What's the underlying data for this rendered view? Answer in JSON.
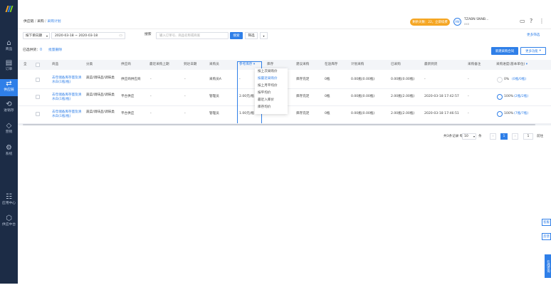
{
  "colors": {
    "primary": "#2f7fe8",
    "sidebar": "#1c2c46",
    "warning": "#f5a623",
    "link": "#2f7fe8"
  },
  "sidebar": {
    "logo_colors": [
      "#f5a623",
      "#2f7fe8",
      "#7ed321"
    ],
    "items": [
      {
        "label": "商品",
        "icon": "shop-icon",
        "glyph": "⌂"
      },
      {
        "label": "订单",
        "icon": "order-icon",
        "glyph": "▤"
      },
      {
        "label": "供应链",
        "icon": "supply-chain-icon",
        "glyph": "⇄"
      },
      {
        "label": "进销存",
        "icon": "inventory-icon",
        "glyph": "⟲"
      },
      {
        "label": "营销",
        "icon": "marketing-icon",
        "glyph": "◇"
      },
      {
        "label": "系统",
        "icon": "system-icon",
        "glyph": "⚙"
      },
      {
        "label": "应用中心",
        "icon": "app-center-icon",
        "glyph": "☷"
      },
      {
        "label": "供应中台",
        "icon": "supply-platform-icon",
        "glyph": "⬡"
      }
    ]
  },
  "header": {
    "breadcrumb": [
      "供应链",
      "采购",
      "采购计划"
    ],
    "trial_badge": "剩余天数：22，立即续费",
    "avatar_text": "AW",
    "user_line1": "TZABN SNNB...",
    "user_line2": "xxx",
    "icons": [
      "chat-icon",
      "help-icon",
      "more-icon"
    ]
  },
  "filters": {
    "date_type": "按下单日期",
    "date_range": "2020-03-18 ~ 2020-03-18",
    "search_label": "搜索",
    "search_placeholder": "输入订单号、商品名称或商家",
    "search_button": "搜索",
    "reset_button": "筛选",
    "more_filters": "更多筛选"
  },
  "toolbar": {
    "summary_prefix": "已选供货：",
    "summary_count": "0",
    "clear_link": "批量删除",
    "new_button": "新建采购合同",
    "more_button": "更多功能"
  },
  "table": {
    "headers": [
      "全",
      "",
      "商品",
      "分类",
      "供应商",
      "最近采购上期",
      "到达日期",
      "采购员",
      "参考库存",
      "库存",
      "建议采购",
      "在途库存",
      "计划采购",
      "已采购",
      "最新到货",
      "采购备注",
      "采购进度(基本单位)"
    ],
    "rows": [
      {
        "product": "去年储备库存量及清水白(1瓶/瓶)",
        "category": "蔬菜/调味品/调味类",
        "supplier": "供应商供应商",
        "last_cycle": "-",
        "arrival": "-",
        "buyer": "采购员A",
        "ref_stock": "-",
        "stock": "库存充足",
        "suggest": "0瓶",
        "transit": "0.00瓶(0.00瓶)",
        "plan": "0.00瓶(0.00瓶)",
        "bought": "0.00瓶(0.00瓶)",
        "latest": "-",
        "remark": "-",
        "progress": "0%",
        "progress_link": "(0瓶/0瓶)",
        "progress_value": 0
      },
      {
        "product": "去年储备库存量及清水白(1瓶/瓶)",
        "category": "蔬菜/调味品/调味类",
        "supplier": "平台供应",
        "last_cycle": "-",
        "arrival": "-",
        "buyer": "管理员",
        "ref_stock": "2.00元/瓶",
        "stock": "库存充足",
        "suggest": "0瓶",
        "transit": "0.00瓶(0.00瓶)",
        "plan": "2.00瓶(2.00瓶)",
        "bought": "2.00瓶(2.00瓶)",
        "latest": "2020-03-18 17:42:57",
        "remark": "-",
        "progress": "100%",
        "progress_link": "(2瓶/2瓶)",
        "progress_value": 1
      },
      {
        "product": "去年储备库存量及清水白(1瓶/瓶)",
        "category": "蔬菜/调味品/调味类",
        "supplier": "平台供应",
        "last_cycle": "-",
        "arrival": "-",
        "buyer": "管理员",
        "ref_stock": "1.00元/瓶",
        "stock": "库存充足",
        "suggest": "0瓶",
        "transit": "0.00瓶(0.00瓶)",
        "plan": "2.00瓶(2.00瓶)",
        "bought": "2.00瓶(2.00瓶)",
        "latest": "2020-03-18 17:46:51",
        "remark": "-",
        "progress": "100%",
        "progress_link": "(7瓶/7瓶)",
        "progress_value": 1
      }
    ]
  },
  "dropdown": {
    "items": [
      "按上次采购价",
      "按最近采购价",
      "按上月平均价",
      "按平均价",
      "最近入库价",
      "库存均价"
    ],
    "active_index": 1
  },
  "pagination": {
    "total": "共3条记录 每页",
    "page_size": "10",
    "unit": "条",
    "current": "1",
    "goto_value": "1",
    "goto_label": "前往"
  },
  "side_tabs": [
    "客服",
    "反馈",
    "在线咨询"
  ]
}
